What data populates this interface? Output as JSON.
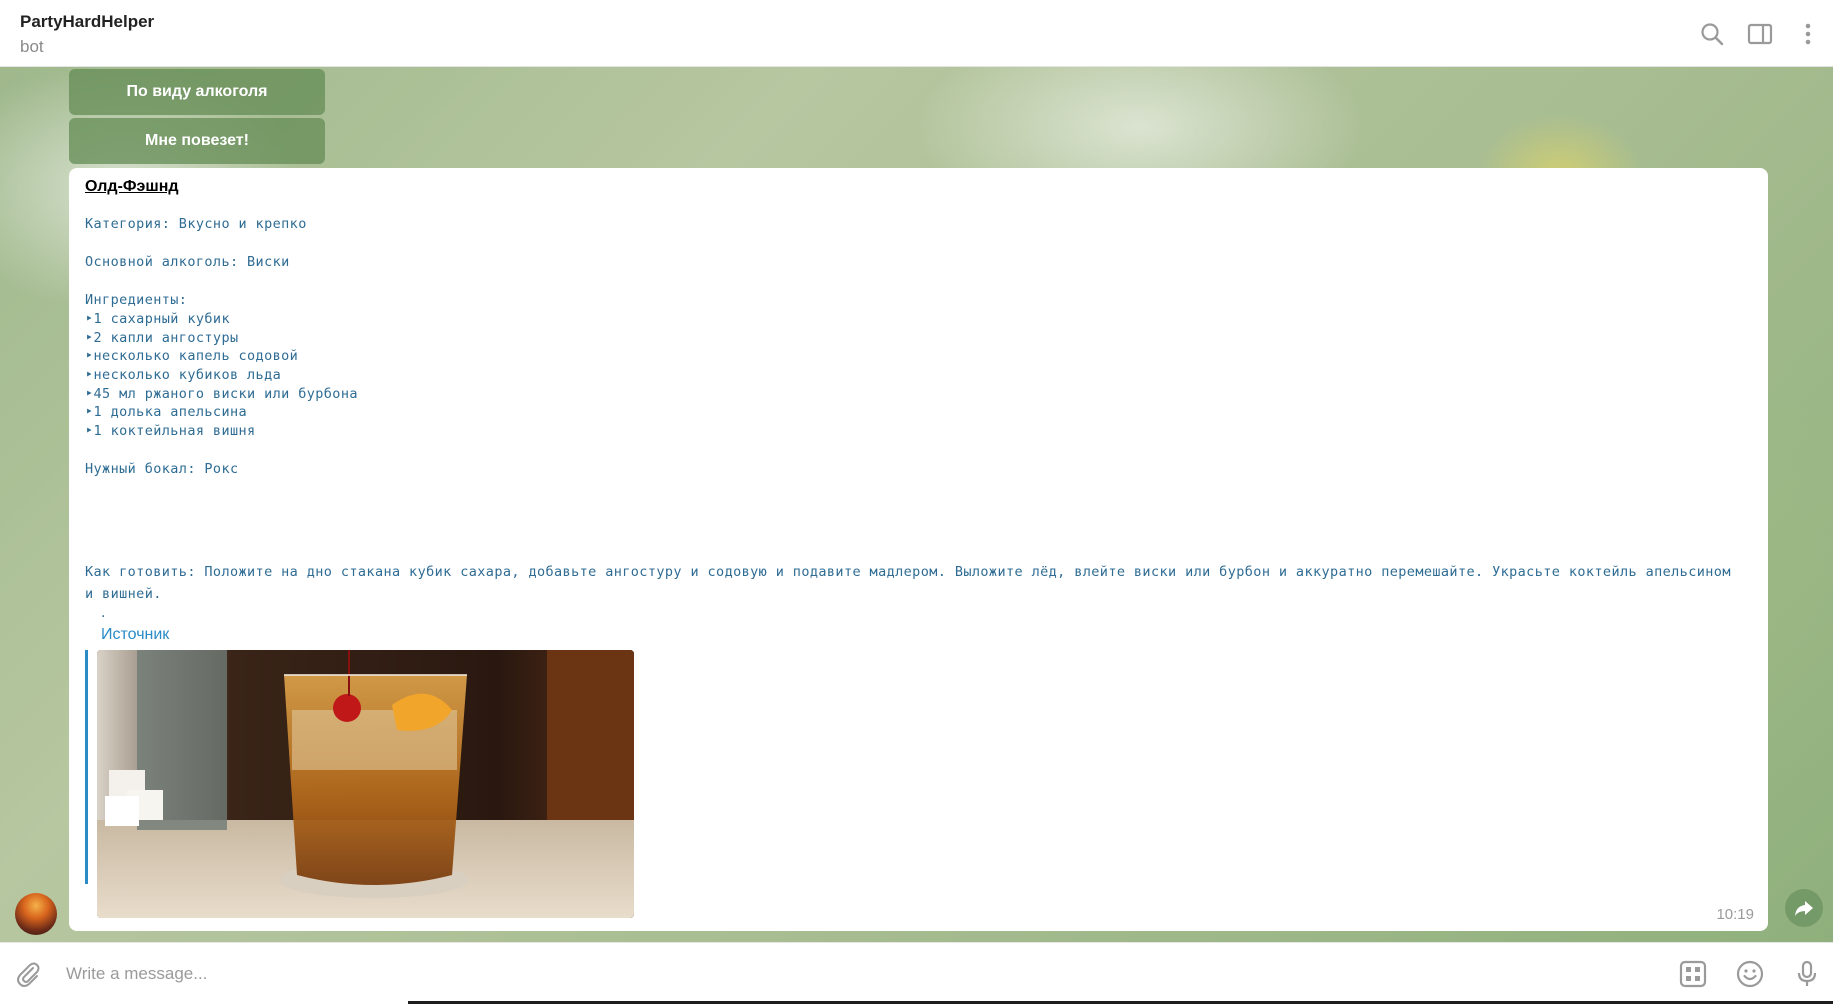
{
  "header": {
    "title": "PartyHardHelper",
    "subtitle": "bot",
    "icons": [
      "search-icon",
      "sidebar-toggle-icon",
      "more-vertical-icon"
    ]
  },
  "keyboard": {
    "buttons": [
      {
        "label": "По виду алкоголя"
      },
      {
        "label": "Мне повезет!"
      }
    ]
  },
  "message": {
    "title": "Олд-Фэшнд",
    "category": "Категория: Вкусно и крепко",
    "base_alcohol": "Основной алкоголь: Виски",
    "ingredients_header": "Ингредиенты:",
    "ingredients": [
      "‣1 сахарный кубик",
      "‣2 капли ангостуры",
      "‣несколько капель содовой",
      "‣несколько кубиков льда",
      "‣45 мл ржаного виски или бурбона",
      "‣1 долька апельсина",
      "‣1 коктейльная вишня"
    ],
    "glass": "Нужный бокал: Рокс",
    "how_to": "Как готовить: Положите на дно стакана кубик сахара, добавьте ангостуру и содовую и подавите мадлером. Выложите лёд, влейте виски или бурбон и аккуратно перемешайте. Украсьте коктейль апельсином и вишней.",
    "dot": ".",
    "source_link": "Источник",
    "time": "10:19"
  },
  "composer": {
    "placeholder": "Write a message...",
    "icons": [
      "attach-icon",
      "bot-commands-icon",
      "emoji-icon",
      "microphone-icon"
    ]
  },
  "colors": {
    "accent": "#2a8bc7",
    "mono_text": "#2f6c94",
    "keyboard_button": "#648c55"
  }
}
